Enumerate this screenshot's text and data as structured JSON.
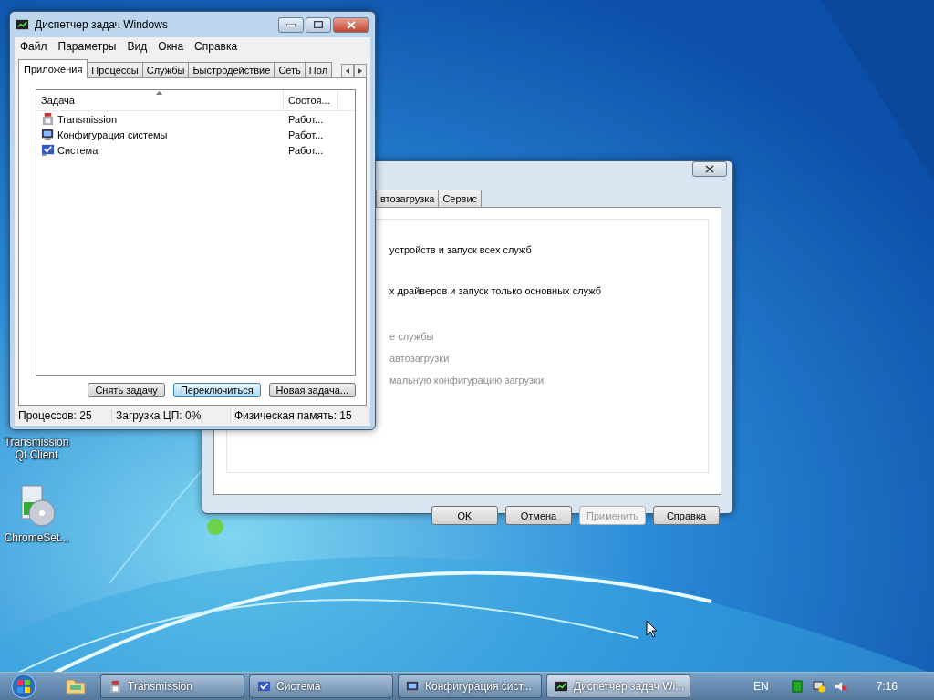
{
  "desktop_icons": [
    {
      "label": "Transmission\nQt Client",
      "kind": "hidden"
    },
    {
      "label": "ChromeSet...",
      "kind": "installer"
    }
  ],
  "msconfig": {
    "tabs": [
      {
        "label": "втозагрузка",
        "selected": false
      },
      {
        "label": "Сервис",
        "selected": false
      }
    ],
    "options": [
      {
        "text": "устройств и запуск всех служб",
        "disabled": false
      },
      {
        "text": "х драйверов и запуск только основных служб",
        "disabled": false
      },
      {
        "text": "е службы",
        "disabled": true
      },
      {
        "text": "автозагрузки",
        "disabled": true
      },
      {
        "text": "мальную конфигурацию загрузки",
        "disabled": true
      }
    ],
    "buttons": [
      {
        "label": "OK",
        "disabled": false
      },
      {
        "label": "Отмена",
        "disabled": false
      },
      {
        "label": "Применить",
        "disabled": true
      },
      {
        "label": "Справка",
        "disabled": false
      }
    ]
  },
  "task_manager": {
    "title": "Диспетчер задач Windows",
    "menu": [
      "Файл",
      "Параметры",
      "Вид",
      "Окна",
      "Справка"
    ],
    "tabs": [
      {
        "label": "Приложения",
        "selected": true
      },
      {
        "label": "Процессы",
        "selected": false
      },
      {
        "label": "Службы",
        "selected": false
      },
      {
        "label": "Быстродействие",
        "selected": false
      },
      {
        "label": "Сеть",
        "selected": false
      },
      {
        "label": "Пол",
        "selected": false
      }
    ],
    "columns": [
      "Задача",
      "Состоя..."
    ],
    "rows": [
      {
        "task": "Transmission",
        "status": "Работ...",
        "kind": "transmission"
      },
      {
        "task": "Конфигурация системы",
        "status": "Работ...",
        "kind": "config"
      },
      {
        "task": "Система",
        "status": "Работ...",
        "kind": "system"
      }
    ],
    "buttons": [
      {
        "label": "Снять задачу",
        "focused": false
      },
      {
        "label": "Переключиться",
        "focused": true
      },
      {
        "label": "Новая задача...",
        "focused": false
      }
    ],
    "status_bar": [
      "Процессов: 25",
      "Загрузка ЦП: 0%",
      "Физическая память: 15"
    ]
  },
  "taskbar": {
    "tasks": [
      {
        "label": "Transmission",
        "kind": "transmission",
        "selected": false
      },
      {
        "label": "Система",
        "kind": "system",
        "selected": false
      },
      {
        "label": "Конфигурация сист...",
        "kind": "config",
        "selected": false
      },
      {
        "label": "Диспетчер задач Wi...",
        "kind": "taskmgr",
        "selected": true
      }
    ],
    "language": "EN",
    "clock": "7:16"
  }
}
